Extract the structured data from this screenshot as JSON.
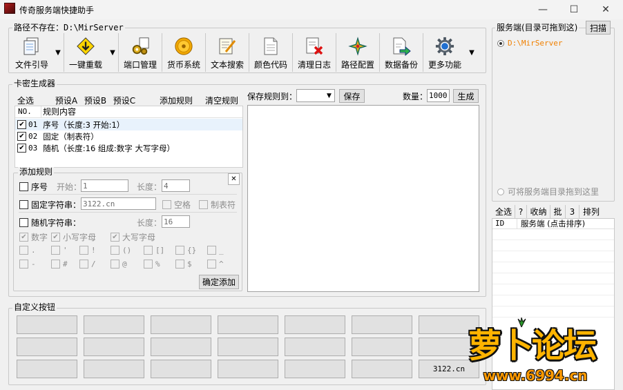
{
  "window": {
    "title": "传奇服务端快捷助手",
    "min": "—",
    "max": "☐",
    "close": "✕"
  },
  "path_group": {
    "label": "路径不存在：D:\\MirServer"
  },
  "toolbar": [
    {
      "label": "文件引导",
      "icon": "file-icon"
    },
    {
      "label": "一键重载",
      "icon": "reload-arrow-icon"
    },
    {
      "label": "端口管理",
      "icon": "gears-icon"
    },
    {
      "label": "货币系统",
      "icon": "coin-icon"
    },
    {
      "label": "文本搜索",
      "icon": "text-edit-icon"
    },
    {
      "label": "颜色代码",
      "icon": "document-icon"
    },
    {
      "label": "清理日志",
      "icon": "clear-log-icon"
    },
    {
      "label": "路径配置",
      "icon": "path-config-icon"
    },
    {
      "label": "数据备份",
      "icon": "backup-icon"
    },
    {
      "label": "更多功能",
      "icon": "settings-gear-icon"
    }
  ],
  "card": {
    "label": "卡密生成器",
    "buttons": {
      "select_all": "全选",
      "preset_a": "预设A",
      "preset_b": "预设B",
      "preset_c": "预设C",
      "add_rule": "添加规则",
      "clear_rule": "清空规则"
    },
    "columns": {
      "no": "NO.",
      "content": "规则内容"
    },
    "rules": [
      {
        "no": "01",
        "content": "序号（长度:3  开始:1）",
        "checked": true
      },
      {
        "no": "02",
        "content": "固定（制表符）",
        "checked": true
      },
      {
        "no": "03",
        "content": "随机（长度:16  组成:数字 大写字母）",
        "checked": true
      }
    ],
    "save_label": "保存规则到：",
    "save_btn": "保存",
    "count_label": "数量：",
    "count_value": "1000",
    "generate_btn": "生成"
  },
  "addrule": {
    "label": "添加规则",
    "close": "✕",
    "serial": "序号",
    "start_label": "开始：",
    "start_value": "1",
    "length_label": "长度：",
    "length_value": "4",
    "fixed": "固定字符串：",
    "fixed_value": "3122.cn",
    "space": "空格",
    "tab": "制表符",
    "random": "随机字符串：",
    "rand_length_label": "长度：",
    "rand_length_value": "16",
    "digits": "数字",
    "lower": "小写字母",
    "upper": "大写字母",
    "symbols_row1": [
      ".",
      "'",
      "!",
      "()",
      "[]",
      "{}",
      "_"
    ],
    "symbols_row2": [
      "-",
      "#",
      "/",
      "@",
      "%",
      "$",
      "^"
    ],
    "confirm": "确定添加"
  },
  "custom": {
    "label": "自定义按钮",
    "last_btn": "3122.cn"
  },
  "server": {
    "label": "服务端(目录可拖到这)",
    "scan": "扫描",
    "selected_path": "D:\\MirServer",
    "drop_hint": "可将服务端目录拖到这里",
    "buttons": {
      "select_all": "全选",
      "help": "?",
      "collect": "收纳",
      "batch": "批",
      "three": "3",
      "sort": "排列"
    },
    "columns": {
      "id": "ID",
      "name": "服务端 (点击排序)"
    }
  },
  "watermark": {
    "brand": "萝卜论坛",
    "site": "www.6994.cn"
  },
  "colors": {
    "accent": "#0060c0",
    "orange": "#f5a000",
    "highlight": "#cce8ff"
  }
}
